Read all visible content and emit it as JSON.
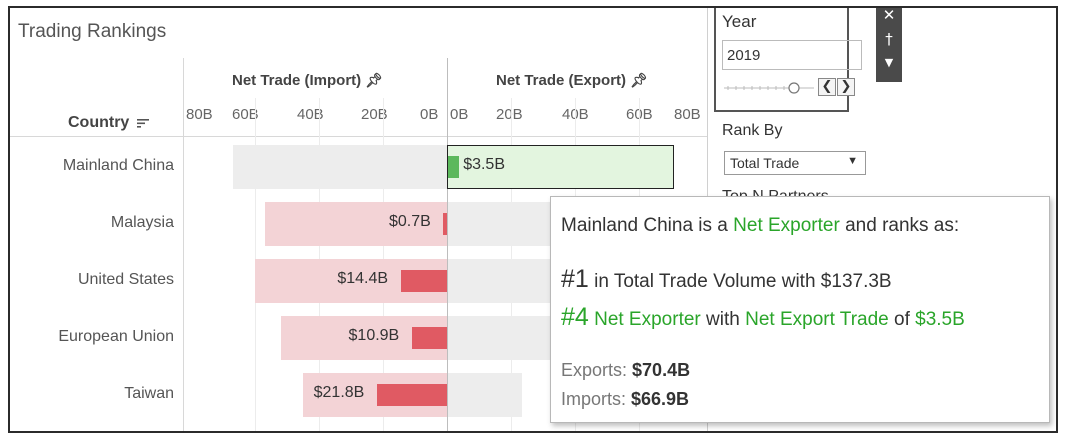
{
  "title": "Trading Rankings",
  "headers": {
    "country": "Country",
    "import": "Net Trade (Import)",
    "export": "Net Trade (Export)"
  },
  "chart_data": {
    "type": "bar",
    "import_ticks": [
      "80B",
      "60B",
      "40B",
      "20B",
      "0B"
    ],
    "export_ticks": [
      "0B",
      "20B",
      "40B",
      "60B",
      "80B"
    ],
    "xlim": [
      0,
      80
    ],
    "rows": [
      {
        "country": "Mainland China",
        "side": "export",
        "net": 3.5,
        "label": "$3.5B",
        "import_total": 66.9,
        "export_total": 70.4
      },
      {
        "country": "Malaysia",
        "side": "import",
        "net": 0.7,
        "label": "$0.7B",
        "import_total": 57,
        "export_total": 56
      },
      {
        "country": "United States",
        "side": "import",
        "net": 14.4,
        "label": "$14.4B",
        "import_total": 60,
        "export_total": 45
      },
      {
        "country": "European Union",
        "side": "import",
        "net": 10.9,
        "label": "$10.9B",
        "import_total": 52,
        "export_total": 41
      },
      {
        "country": "Taiwan",
        "side": "import",
        "net": 21.8,
        "label": "$21.8B",
        "import_total": 45,
        "export_total": 23
      }
    ],
    "colors": {
      "import_total": "#f3d3d6",
      "import_net": "#e05a63",
      "export_total_bg": "#ededed",
      "export_net": "#5cb85c",
      "export_selected_bg": "#e3f5df"
    }
  },
  "filters": {
    "year_title": "Year",
    "year_value": "2019",
    "rank_title": "Rank By",
    "rank_value": "Total Trade",
    "hidden_label": "Top N Partners"
  },
  "tooltip": {
    "country": "Mainland China",
    "is_a": " is a ",
    "role": "Net Exporter",
    "ranks_as": " and ranks as:",
    "rank1": "#1",
    "rank1_text": " in Total Trade Volume with $137.3B",
    "rank2": "#4",
    "rank2_role": " Net Exporter",
    "rank2_with": " with ",
    "rank2_measure": "Net Export Trade",
    "rank2_of": " of ",
    "rank2_value": "$3.5B",
    "exports_label": "Exports: ",
    "exports_value": "$70.4B",
    "imports_label": "Imports: ",
    "imports_value": "$66.9B"
  }
}
